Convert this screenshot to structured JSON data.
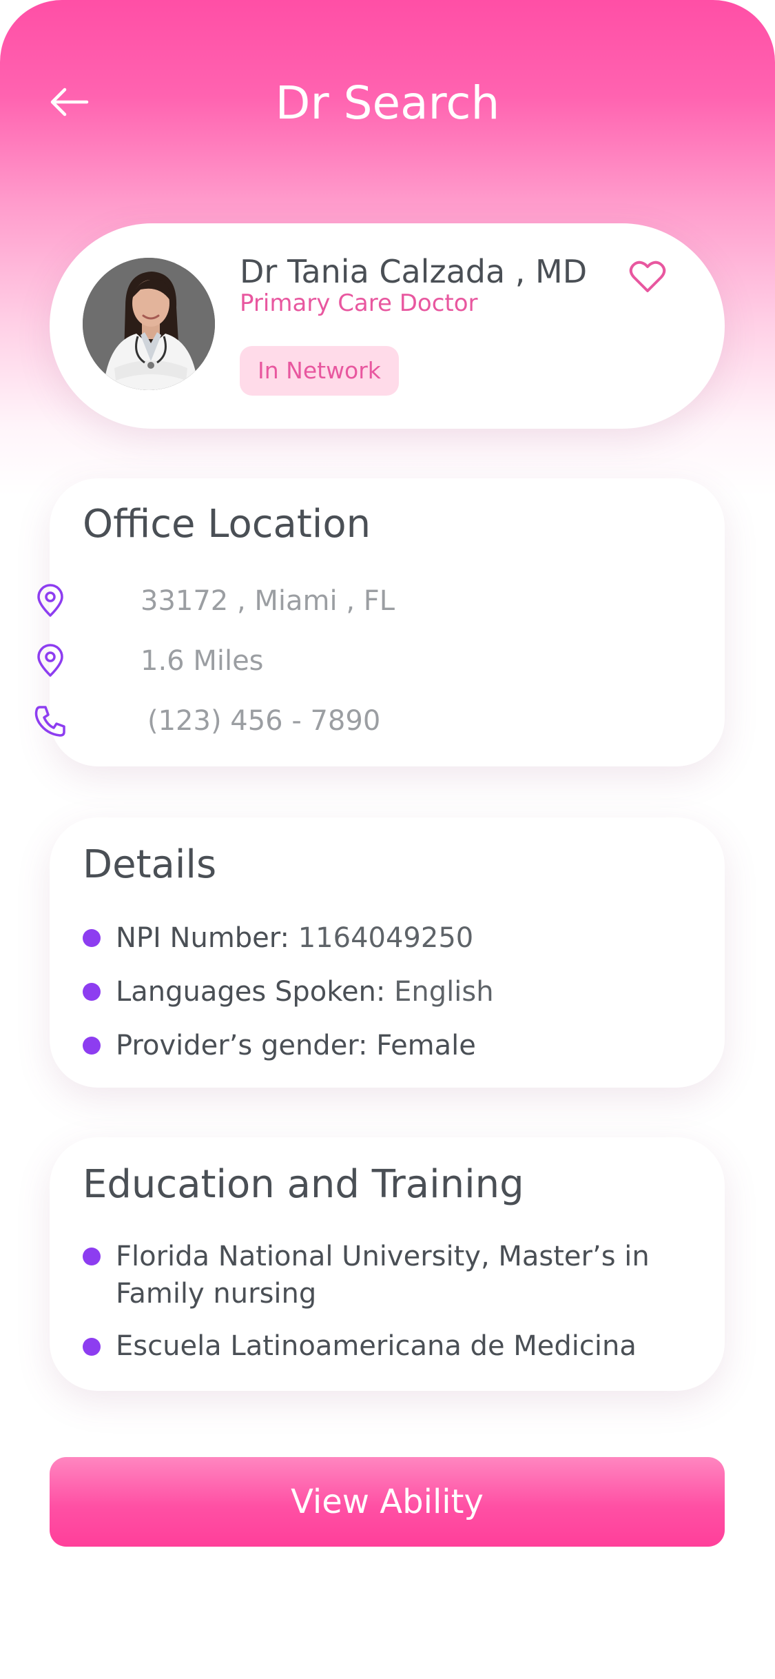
{
  "header": {
    "title": "Dr Search"
  },
  "doctor": {
    "name": "Dr Tania Calzada , MD",
    "specialty": "Primary Care Doctor",
    "network_badge": "In Network"
  },
  "office": {
    "title": "Office Location",
    "address": "33172 , Miami , FL",
    "distance": "1.6 Miles",
    "phone": "(123) 456 - 7890"
  },
  "details": {
    "title": "Details",
    "npi_label": "NPI Number: ",
    "npi_value": "1164049250",
    "languages_label": "Languages Spoken: ",
    "languages_value": "English",
    "gender_label": "Provider’s gender: ",
    "gender_value": "Female"
  },
  "education": {
    "title": "Education and Training",
    "items": [
      "Florida National University, Master’s in Family nursing",
      "Escuela Latinoamericana de Medicina"
    ]
  },
  "action": {
    "view_ability_label": "View Ability"
  },
  "colors": {
    "brand_pink": "#ff4fa6",
    "accent_purple": "#8d3df0",
    "text_dark": "#4a4f55",
    "text_muted": "#9b9ea2",
    "badge_bg": "#ffdbe9"
  },
  "icons": {
    "back": "arrow-left-icon",
    "favorite": "heart-icon",
    "location": "map-pin-icon",
    "phone": "phone-icon"
  }
}
